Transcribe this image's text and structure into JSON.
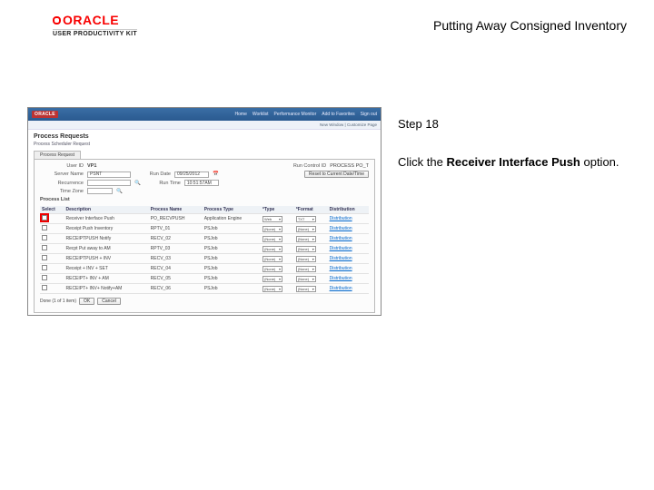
{
  "doc": {
    "title": "Putting Away Consigned Inventory",
    "logo_text": "ORACLE",
    "upk_text": "USER PRODUCTIVITY KIT"
  },
  "instruction": {
    "step_label": "Step 18",
    "line1_pre": "Click the ",
    "line1_bold": "Receiver Interface Push",
    "line1_post": " option."
  },
  "ss": {
    "oracle": "ORACLE",
    "nav": [
      "Home",
      "Worklist",
      "Performance Monitor",
      "Add to Favorites",
      "Sign out"
    ],
    "breadcrumb": "New Window | Customize Page",
    "h1": "Process Requests",
    "sub": "Process Scheduler Request",
    "tab": "Process Request",
    "user_id_label": "User ID",
    "user_id_value": "VP1",
    "run_cntl_label": "Run Control ID",
    "run_cntl_value": "PROCESS PO_T",
    "server_label": "Server Name",
    "server_value": "PSNT",
    "rundate_label": "Run Date",
    "rundate_value": "09/25/2012",
    "recur_label": "Recurrence",
    "reset_btn": "Reset to Current Date/Time",
    "runtime_label": "Run Time",
    "runtime_value": "10:51:57AM",
    "timezone_label": "Time Zone",
    "process_list": "Process List",
    "cols": [
      "Select",
      "Description",
      "Process Name",
      "Process Type",
      "*Type",
      "*Format",
      "Distribution"
    ],
    "rows": [
      {
        "sel": true,
        "desc": "Receiver Interface Push",
        "name": "PO_RECVPUSH",
        "type": "Application Engine",
        "t": "Web",
        "f": "TXT",
        "dist": "Distribution"
      },
      {
        "sel": false,
        "desc": "Receipt Push Inventory",
        "name": "RPTV_01",
        "type": "PSJob",
        "t": "(None)",
        "f": "(None)",
        "dist": "Distribution"
      },
      {
        "sel": false,
        "desc": "RECEIPTPUSH Notify",
        "name": "RECV_02",
        "type": "PSJob",
        "t": "(None)",
        "f": "(None)",
        "dist": "Distribution"
      },
      {
        "sel": false,
        "desc": "Recpt Put away to AM",
        "name": "RPTV_03",
        "type": "PSJob",
        "t": "(None)",
        "f": "(None)",
        "dist": "Distribution"
      },
      {
        "sel": false,
        "desc": "RECEIPTPUSH + INV",
        "name": "RECV_03",
        "type": "PSJob",
        "t": "(None)",
        "f": "(None)",
        "dist": "Distribution"
      },
      {
        "sel": false,
        "desc": "Receipt + INV + SET",
        "name": "RECV_04",
        "type": "PSJob",
        "t": "(None)",
        "f": "(None)",
        "dist": "Distribution"
      },
      {
        "sel": false,
        "desc": "RECEIPT+ INV + AM",
        "name": "RECV_05",
        "type": "PSJob",
        "t": "(None)",
        "f": "(None)",
        "dist": "Distribution"
      },
      {
        "sel": false,
        "desc": "RECEIPT+ INV+ Notify+AM",
        "name": "RECV_06",
        "type": "PSJob",
        "t": "(None)",
        "f": "(None)",
        "dist": "Distribution"
      }
    ],
    "ok_btn": "OK",
    "cancel_btn": "Cancel",
    "done_text": "Done  (1 of 1 item)"
  }
}
